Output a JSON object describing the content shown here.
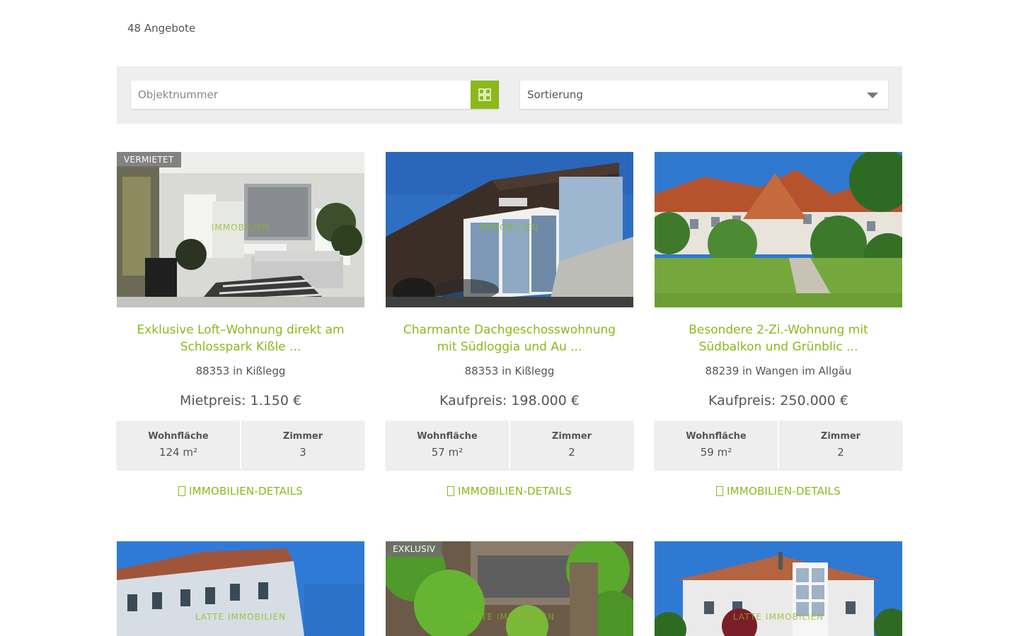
{
  "listing": {
    "count_text": "48 Angebote"
  },
  "filters": {
    "search_placeholder": "Objektnummer",
    "search_icon": "grid-search-icon",
    "sort_label": "Sortierung"
  },
  "colors": {
    "accent": "#8cb81a",
    "panel": "#eeeeee",
    "text": "#555555"
  },
  "properties": [
    {
      "badge": "VERMIETET",
      "watermark": "IMMOBILIEN",
      "title_line1": "Exklusive Loft–Wohnung direkt am",
      "title_line2": "Schlosspark Kißle ...",
      "location": "88353 in Kißlegg",
      "price": "Mietpreis: 1.150 €",
      "area_label": "Wohnfläche",
      "area_value": "124 m²",
      "rooms_label": "Zimmer",
      "rooms_value": "3",
      "details_label": "IMMOBILIEN-DETAILS"
    },
    {
      "badge": "",
      "watermark": "IMMOBILIEN",
      "title_line1": "Charmante Dachgeschosswohnung",
      "title_line2": "mit Südloggia und Au ...",
      "location": "88353 in Kißlegg",
      "price": "Kaufpreis: 198.000 €",
      "area_label": "Wohnfläche",
      "area_value": "57 m²",
      "rooms_label": "Zimmer",
      "rooms_value": "2",
      "details_label": "IMMOBILIEN-DETAILS"
    },
    {
      "badge": "",
      "watermark": "",
      "title_line1": "Besondere 2-Zi.-Wohnung mit",
      "title_line2": "Südbalkon und Grünblic ...",
      "location": "88239 in Wangen im Allgäu",
      "price": "Kaufpreis: 250.000 €",
      "area_label": "Wohnfläche",
      "area_value": "59 m²",
      "rooms_label": "Zimmer",
      "rooms_value": "2",
      "details_label": "IMMOBILIEN-DETAILS"
    },
    {
      "badge": "",
      "watermark": "LATTE IMMOBILIEN"
    },
    {
      "badge": "EXKLUSIV",
      "watermark": "LATTE IMMOBILIEN"
    },
    {
      "badge": "",
      "watermark": "LATTE IMMOBILIEN"
    }
  ]
}
